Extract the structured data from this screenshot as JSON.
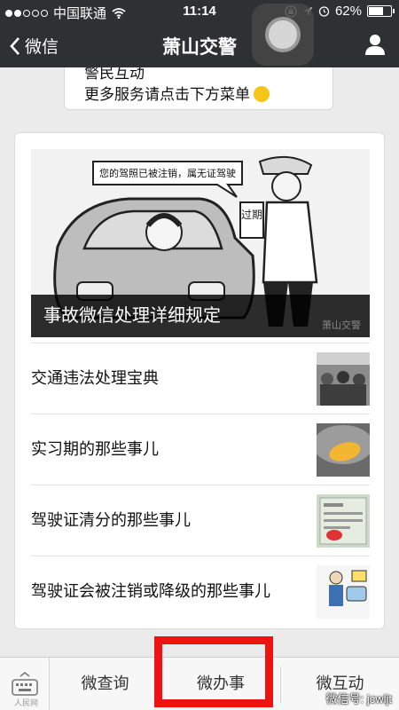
{
  "status_bar": {
    "carrier": "中国联通",
    "time": "11:14",
    "battery": "62%"
  },
  "nav": {
    "back_label": "微信",
    "title": "萧山交警"
  },
  "prev_message": {
    "line1": "警民互动",
    "line2": "更多服务请点击下方菜单"
  },
  "article": {
    "cover_caption": "事故微信处理详细规定",
    "cover_speech": "您的驾照已被注销，属无证驾驶",
    "cover_sign": "过期",
    "watermark": "萧山交警",
    "items": [
      {
        "title": "交通违法处理宝典",
        "thumb": "photo-crowd"
      },
      {
        "title": "实习期的那些事儿",
        "thumb": "photo-intern-sticker"
      },
      {
        "title": "驾驶证清分的那些事儿",
        "thumb": "photo-license-document"
      },
      {
        "title": "驾驶证会被注销或降级的那些事儿",
        "thumb": "photo-cartoon-police"
      }
    ]
  },
  "bottom_menu": {
    "items": [
      "微查询",
      "微办事",
      "微互动"
    ],
    "highlighted": "微办事",
    "watermark_left": "人民网",
    "watermark_right": "微信号: jcwljt"
  },
  "colors": {
    "nav_bg": "#2e3132",
    "highlight": "#ee1313"
  }
}
